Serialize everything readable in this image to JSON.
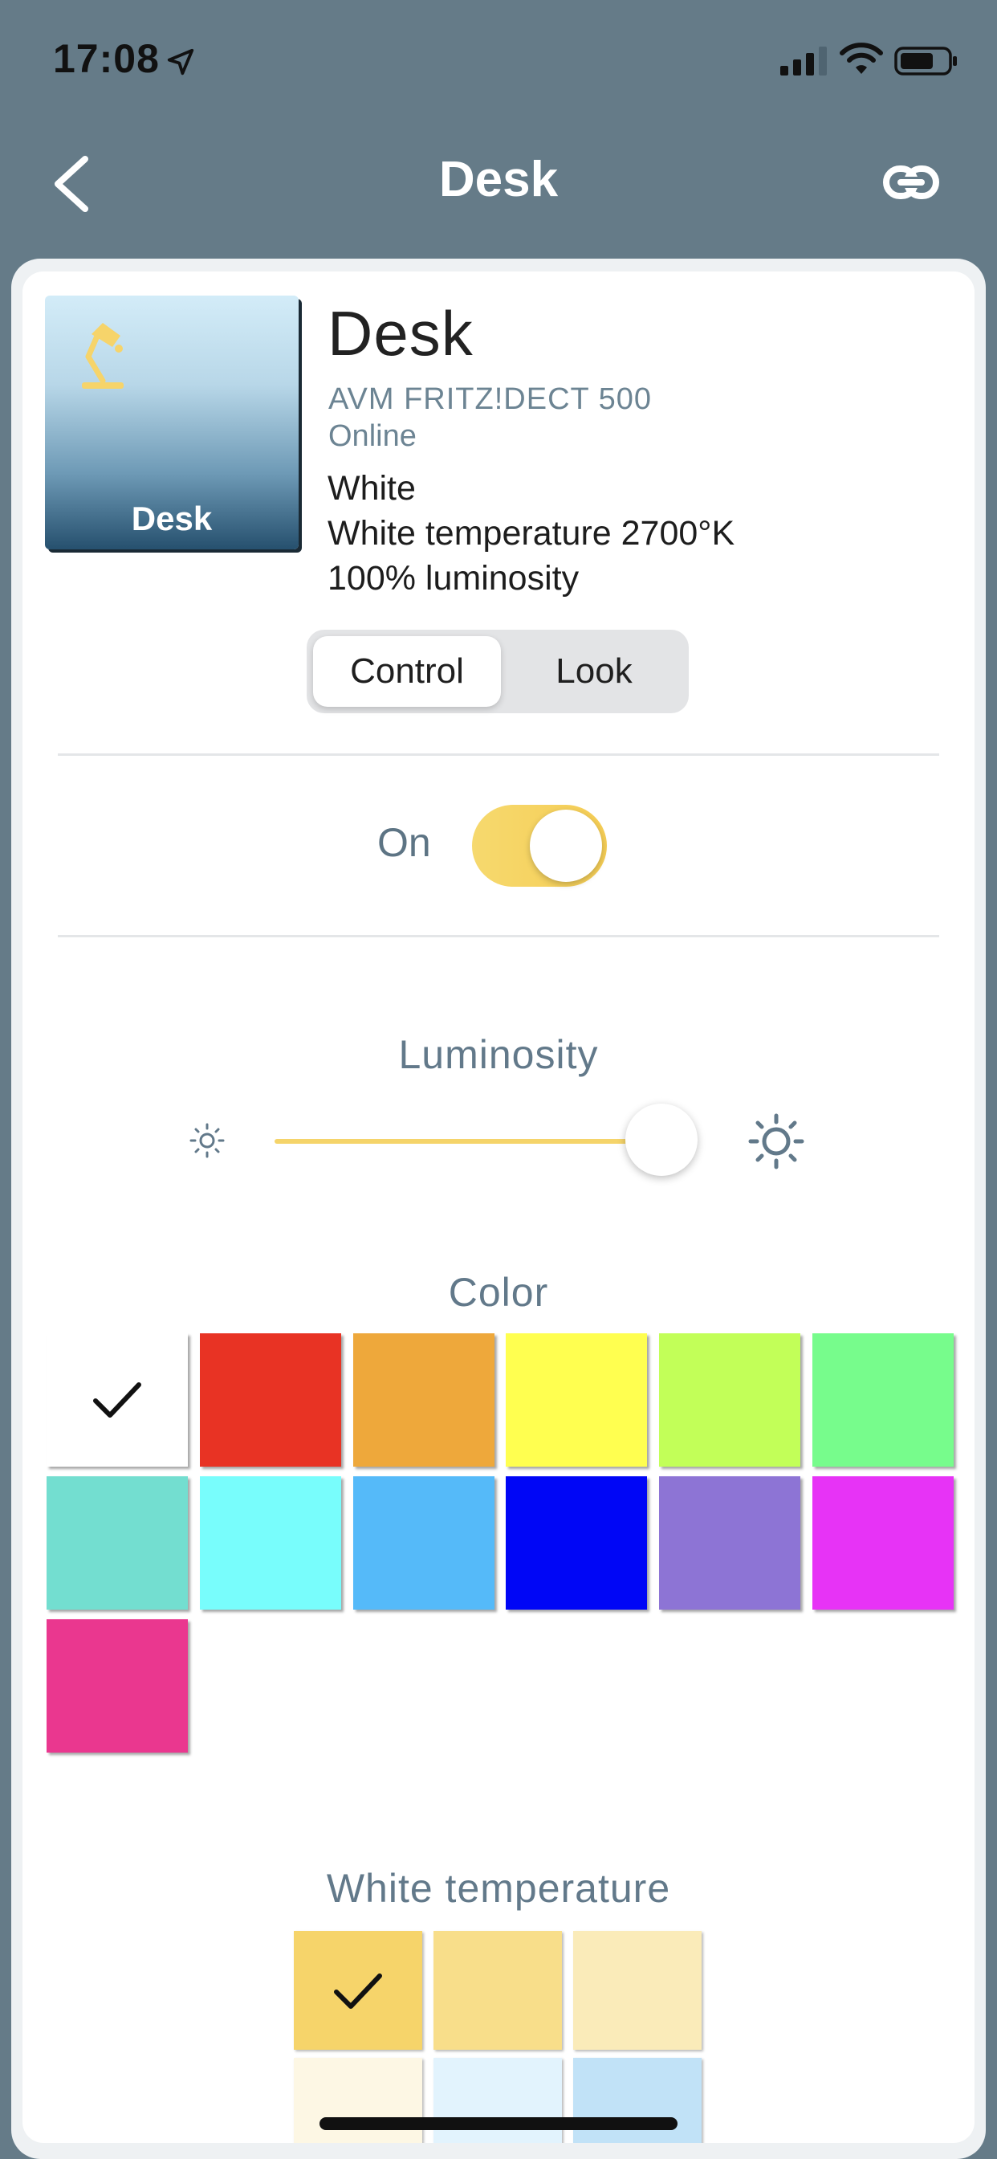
{
  "status_bar": {
    "time": "17:08"
  },
  "nav": {
    "title": "Desk"
  },
  "device": {
    "thumbnail_label": "Desk",
    "name": "Desk",
    "model": "AVM FRITZ!DECT 500",
    "status": "Online",
    "mode": "White",
    "temperature_text": "White temperature 2700°K",
    "luminosity_text": "100% luminosity"
  },
  "segment": {
    "control_label": "Control",
    "look_label": "Look",
    "selected": "Control"
  },
  "power": {
    "label": "On",
    "is_on": true
  },
  "luminosity": {
    "title": "Luminosity",
    "value_percent": 100
  },
  "color": {
    "title": "Color",
    "swatches": [
      "#ffffff",
      "#e83324",
      "#eea83b",
      "#ffff50",
      "#c2ff58",
      "#77fc8c",
      "#73ded0",
      "#78fdfc",
      "#55baf9",
      "#0006f6",
      "#8d74d5",
      "#e733f6",
      "#ea378f"
    ],
    "selected_index": 0
  },
  "white_temperature": {
    "title": "White temperature",
    "swatches": [
      "#f6d46a",
      "#f8de8a",
      "#faebb9",
      "#fdf7e4",
      "#e2f3fd",
      "#c1e2f7"
    ],
    "selected_index": 0
  },
  "colors": {
    "background": "#657b88",
    "accent": "#f5cd55",
    "label": "#62798a"
  }
}
